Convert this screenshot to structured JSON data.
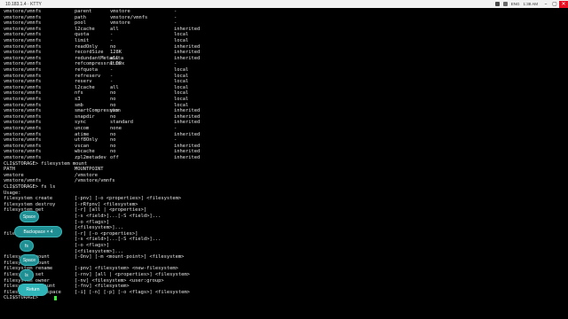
{
  "window": {
    "title": "10.183.1.4 · KTTY",
    "tray": [
      "ENG",
      "1:38 AM"
    ],
    "accent": "#e81123"
  },
  "properties": [
    [
      "vmstore/vmnfs",
      "parent",
      "vmstore",
      "-"
    ],
    [
      "vmstore/vmnfs",
      "path",
      "vmstore/vmnfs",
      "-"
    ],
    [
      "vmstore/vmnfs",
      "pool",
      "vmstore",
      "-"
    ],
    [
      "vmstore/vmnfs",
      "l2cache",
      "all",
      "inherited"
    ],
    [
      "vmstore/vmnfs",
      "quota",
      "-",
      "local"
    ],
    [
      "vmstore/vmnfs",
      "limit",
      "-",
      "local"
    ],
    [
      "vmstore/vmnfs",
      "readOnly",
      "no",
      "inherited"
    ],
    [
      "vmstore/vmnfs",
      "recordSize",
      "128K",
      "inherited"
    ],
    [
      "vmstore/vmnfs",
      "redundantMetadata",
      "all",
      "inherited"
    ],
    [
      "vmstore/vmnfs",
      "refcompressratio",
      "1.00x",
      "-"
    ],
    [
      "vmstore/vmnfs",
      "refquota",
      "-",
      "local"
    ],
    [
      "vmstore/vmnfs",
      "refreserv",
      "-",
      "local"
    ],
    [
      "vmstore/vmnfs",
      "reserv",
      "-",
      "local"
    ],
    [
      "vmstore/vmnfs",
      "l2cache",
      "all",
      "local"
    ],
    [
      "vmstore/vmnfs",
      "nfs",
      "no",
      "local"
    ],
    [
      "vmstore/vmnfs",
      "s3",
      "no",
      "local"
    ],
    [
      "vmstore/vmnfs",
      "smb",
      "no",
      "local"
    ],
    [
      "vmstore/vmnfs",
      "smartCompression",
      "yes",
      "inherited"
    ],
    [
      "vmstore/vmnfs",
      "snapdir",
      "no",
      "inherited"
    ],
    [
      "vmstore/vmnfs",
      "sync",
      "standard",
      "inherited"
    ],
    [
      "vmstore/vmnfs",
      "uncom",
      "none",
      "-"
    ],
    [
      "vmstore/vmnfs",
      "atime",
      "no",
      "inherited"
    ],
    [
      "vmstore/vmnfs",
      "utf8Only",
      "no",
      "-"
    ],
    [
      "vmstore/vmnfs",
      "vscan",
      "no",
      "inherited"
    ],
    [
      "vmstore/vmnfs",
      "wbcache",
      "no",
      "inherited"
    ],
    [
      "vmstore/vmnfs",
      "zpl2metadev",
      "off",
      "inherited"
    ]
  ],
  "prompt1": "CLI$STORAGE> filesystem mount",
  "mount_header": [
    "PATH",
    "MOUNTPOINT"
  ],
  "mounts": [
    [
      "vmstore",
      "/vmstore"
    ],
    [
      "vmstore/vmnfs",
      "/vmstore/vmnfs"
    ]
  ],
  "prompt2": "CLI$STORAGE> fs ls",
  "usage_label": "Usage:",
  "usage": [
    [
      "filesystem create",
      "[-pnv] [-o <properties>] <filesystem>"
    ],
    [
      "filesystem destroy",
      "[-rRfpnv] <filesystem>"
    ],
    [
      "filesystem get",
      "[-r] [all | <properties>]"
    ],
    [
      "",
      "[-s <field>]...[-S <field>]..."
    ],
    [
      "",
      "[-o <flags>]"
    ],
    [
      "",
      "[<filesystem>]..."
    ],
    [
      "filesystem list",
      "[-r] [-o <properties>]"
    ],
    [
      "",
      "[-s <field>]...[-S <field>]..."
    ],
    [
      "",
      "[-o <flags>]"
    ],
    [
      "",
      "[<filesystem>]..."
    ],
    [
      "filesystem mount",
      "[-Onv] [-m <mount-point>] <filesystem>"
    ],
    [
      "filesystem mount",
      ""
    ],
    [
      "filesystem rename",
      "[-pnv] <filesystem> <new-filesystem>"
    ],
    [
      "filesystem set",
      "[-rnv] [all | <properties>] <filesystem>"
    ],
    [
      "filesystem owner",
      "[-nv] <filesystem> <user:group>"
    ],
    [
      "filesystem unmount",
      "[-fnv] <filesystem>"
    ],
    [
      "filesystem userspace",
      "[-i] [-n] [-p] [-o <flags>] <filesystem>"
    ]
  ],
  "prompt3": "CLI$STORAGE> ",
  "keystrokes": [
    "Space",
    "Backspace × 4",
    "fs",
    "Space",
    "ls",
    "Return"
  ]
}
